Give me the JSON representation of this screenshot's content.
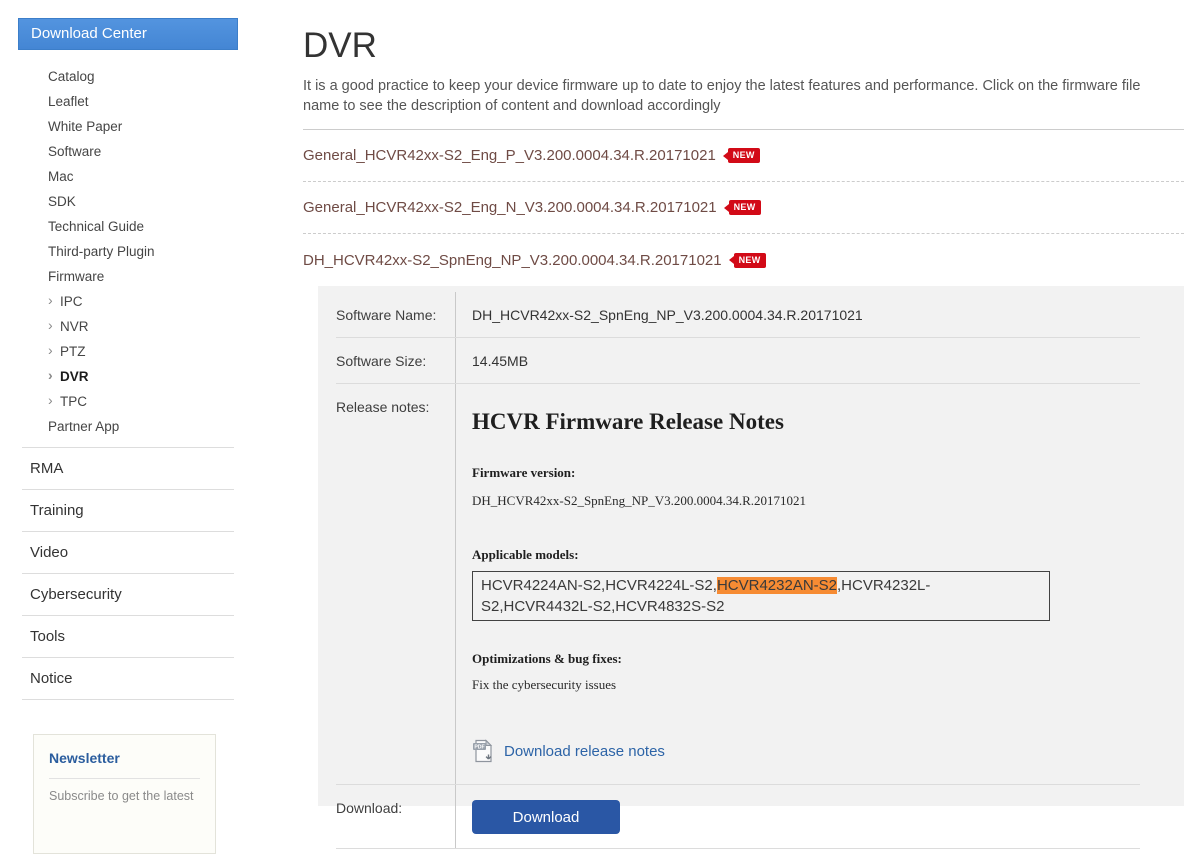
{
  "sidebar": {
    "header": "Download Center",
    "items": [
      "Catalog",
      "Leaflet",
      "White Paper",
      "Software",
      "Mac",
      "SDK",
      "Technical Guide",
      "Third-party Plugin",
      "Firmware"
    ],
    "sub_items": [
      {
        "label": "IPC",
        "active": false
      },
      {
        "label": "NVR",
        "active": false
      },
      {
        "label": "PTZ",
        "active": false
      },
      {
        "label": "DVR",
        "active": true
      },
      {
        "label": "TPC",
        "active": false
      }
    ],
    "partner_app": "Partner App",
    "sections": [
      "RMA",
      "Training",
      "Video",
      "Cybersecurity",
      "Tools",
      "Notice"
    ],
    "newsletter": {
      "title": "Newsletter",
      "subtitle": "Subscribe to get the latest"
    }
  },
  "main": {
    "title": "DVR",
    "description": "It is a good practice to keep your device firmware up to date to enjoy the latest features and performance. Click on the firmware file name to see the description of content and download accordingly",
    "badge_new": "NEW",
    "firmware_list": [
      "General_HCVR42xx-S2_Eng_P_V3.200.0004.34.R.20171021",
      "General_HCVR42xx-S2_Eng_N_V3.200.0004.34.R.20171021",
      "DH_HCVR42xx-S2_SpnEng_NP_V3.200.0004.34.R.20171021"
    ],
    "details": {
      "software_name_label": "Software Name:",
      "software_name": "DH_HCVR42xx-S2_SpnEng_NP_V3.200.0004.34.R.20171021",
      "software_size_label": "Software Size:",
      "software_size": "14.45MB",
      "release_notes_label": "Release notes:",
      "notes": {
        "title": "HCVR Firmware Release Notes",
        "firmware_version_label": "Firmware version:",
        "firmware_version": "DH_HCVR42xx-S2_SpnEng_NP_V3.200.0004.34.R.20171021",
        "applicable_models_label": "Applicable models:",
        "models_before": "HCVR4224AN-S2,HCVR4224L-S2,",
        "models_highlight": "HCVR4232AN-S2",
        "models_after": ",HCVR4232L-S2,HCVR4432L-S2,HCVR4832S-S2",
        "optimizations_label": "Optimizations & bug fixes:",
        "optimizations_text": "Fix the cybersecurity issues",
        "download_notes_link": "Download release notes"
      },
      "download_label": "Download:",
      "download_button": "Download"
    }
  },
  "colors": {
    "header_blue": "#4a8eda",
    "badge_red": "#d20a17",
    "highlight_orange": "#f68b33",
    "button_blue": "#2a57a5",
    "link_blue": "#2d64a7"
  }
}
